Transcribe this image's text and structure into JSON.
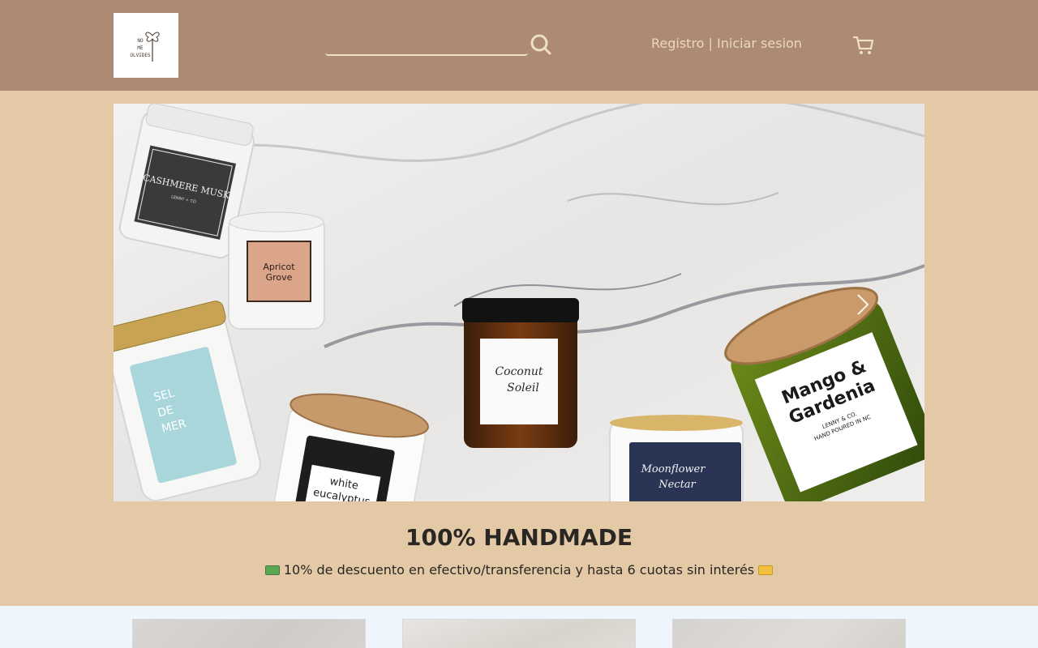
{
  "header": {
    "logo_text": "NO\nME\nOLVIDES",
    "search": {
      "value": "",
      "placeholder": ""
    },
    "auth": {
      "register": "Registro",
      "separator": " | ",
      "login": "Iniciar sesion"
    }
  },
  "hero": {
    "labels": {
      "cashmere": "CASHMERE MUSK",
      "cashmere_sub": "LENNY + CO",
      "apricot": "Apricot\nGrove",
      "sel": "SEL\nDE\nMER",
      "coconut": "Coconut\nSoleil",
      "white": "white\neucalyptus",
      "moonflower": "Moonflower\nNectar",
      "mango": "Mango &\nGardenia",
      "mango_sub": "LENNY & CO.\nHAND POURED IN NC"
    }
  },
  "content": {
    "headline": "100% HANDMADE",
    "promo": "10% de descuento en efectivo/transferencia y hasta 6 cuotas sin interés"
  },
  "colors": {
    "header_bg": "#ad8a72",
    "page_bg": "#e3c9a6",
    "band_bg": "#eef5fc",
    "accent_text": "#ead8bf"
  },
  "icons": [
    "logo-flower-icon",
    "search-icon",
    "cart-icon",
    "chevron-right-icon",
    "cash-emoji-icon",
    "credit-card-emoji-icon"
  ]
}
